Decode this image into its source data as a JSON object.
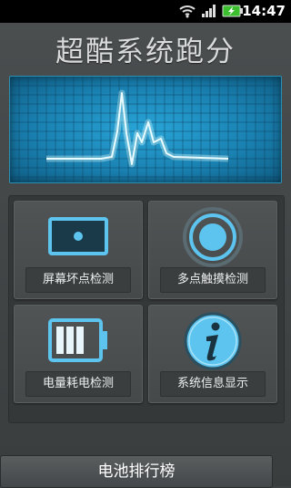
{
  "status_bar": {
    "time": "14:47",
    "icons": [
      "wifi-icon",
      "signal-icon",
      "battery-charging-icon"
    ]
  },
  "app": {
    "title": "超酷系统跑分",
    "tiles": [
      {
        "label": "屏幕坏点检测",
        "icon": "screen-icon"
      },
      {
        "label": "多点触摸检测",
        "icon": "multitouch-icon"
      },
      {
        "label": "电量耗电检测",
        "icon": "battery-icon"
      },
      {
        "label": "系统信息显示",
        "icon": "info-icon"
      }
    ],
    "bottom_button": "电池排行榜"
  },
  "colors": {
    "accent": "#2aa8dc",
    "background": "#3e4243",
    "icon_blue": "#5cc4ee"
  }
}
